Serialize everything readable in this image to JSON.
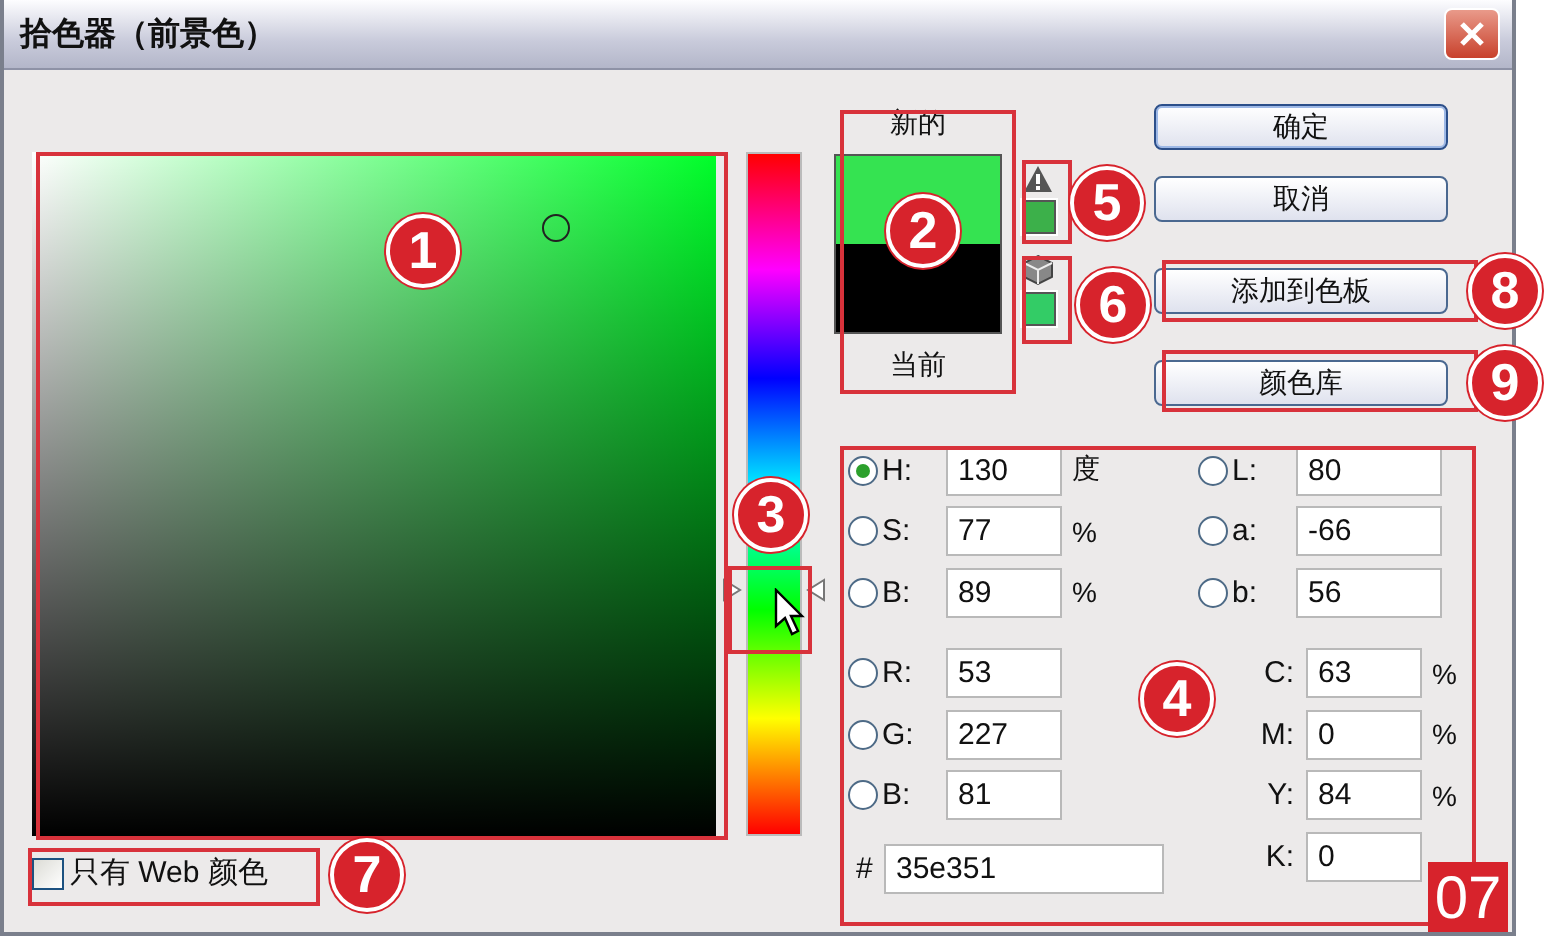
{
  "window": {
    "title": "拾色器（前景色）"
  },
  "hue_slider": {
    "level": 0.361
  },
  "preview": {
    "new_label": "新的",
    "current_label": "当前",
    "swatches": [
      {
        "color": "#35e351"
      },
      {
        "color": "#000000"
      }
    ]
  },
  "warnings": [
    {
      "kind": "gamut",
      "color": "#3cb04a"
    },
    {
      "kind": "web",
      "color": "#33cc66"
    }
  ],
  "buttons": [
    {
      "label": "确定",
      "primary": true
    },
    {
      "label": "取消",
      "primary": false
    },
    {
      "label": "添加到色板",
      "primary": false
    },
    {
      "label": "颜色库",
      "primary": false
    }
  ],
  "fields_left": [
    {
      "kind": "radio",
      "label": "H:",
      "value": "130",
      "unit": "度",
      "selected": true
    },
    {
      "kind": "radio",
      "label": "S:",
      "value": "77",
      "unit": "%",
      "selected": false
    },
    {
      "kind": "radio",
      "label": "B:",
      "value": "89",
      "unit": "%",
      "selected": false
    },
    {
      "kind": "radio",
      "label": "R:",
      "value": "53",
      "selected": false
    },
    {
      "kind": "radio",
      "label": "G:",
      "value": "227",
      "selected": false
    },
    {
      "kind": "radio",
      "label": "B:",
      "value": "81",
      "selected": false
    }
  ],
  "fields_right": [
    {
      "kind": "radio",
      "label": "L:",
      "value": "80",
      "selected": false
    },
    {
      "kind": "radio",
      "label": "a:",
      "value": "-66",
      "selected": false
    },
    {
      "kind": "radio",
      "label": "b:",
      "value": "56",
      "selected": false
    },
    {
      "kind": "plain",
      "label": "C:",
      "value": "63",
      "unit": "%"
    },
    {
      "kind": "plain",
      "label": "M:",
      "value": "0",
      "unit": "%"
    },
    {
      "kind": "plain",
      "label": "Y:",
      "value": "84",
      "unit": "%"
    },
    {
      "kind": "plain",
      "label": "K:",
      "value": "0"
    }
  ],
  "hex": {
    "label": "#",
    "value": "35e351"
  },
  "web_only": {
    "label": "只有 Web 颜色",
    "checked": false
  },
  "callouts": [
    {
      "label": "1"
    },
    {
      "label": "2"
    },
    {
      "label": "3"
    },
    {
      "label": "4"
    },
    {
      "label": "5"
    },
    {
      "label": "6"
    },
    {
      "label": "7"
    },
    {
      "label": "8"
    },
    {
      "label": "9"
    }
  ],
  "badge": "07"
}
